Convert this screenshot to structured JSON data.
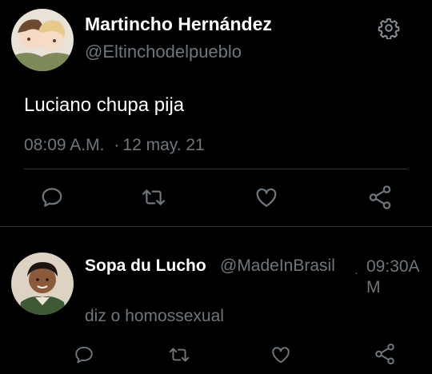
{
  "tweet": {
    "author_name": "Martincho Hernández",
    "author_handle": "@Eltinchodelpueblo",
    "text": "Luciano chupa pija",
    "time": "08:09 A.M.",
    "separator": "·",
    "date": "12 may. 21",
    "icons": {
      "settings": "gear-icon",
      "reply": "reply-icon",
      "retweet": "retweet-icon",
      "like": "heart-icon",
      "share": "share-icon"
    }
  },
  "reply": {
    "author_name": "Sopa du Lucho",
    "author_handle": "@MadeInBrasil",
    "separator": "·",
    "time": "09:30AM",
    "text": "diz o homossexual",
    "icons": {
      "reply": "reply-icon",
      "retweet": "retweet-icon",
      "like": "heart-icon",
      "share": "share-icon"
    }
  },
  "colors": {
    "background": "#000000",
    "primary_text": "#ffffff",
    "secondary_text": "#6e767d",
    "divider": "#2f3336"
  }
}
